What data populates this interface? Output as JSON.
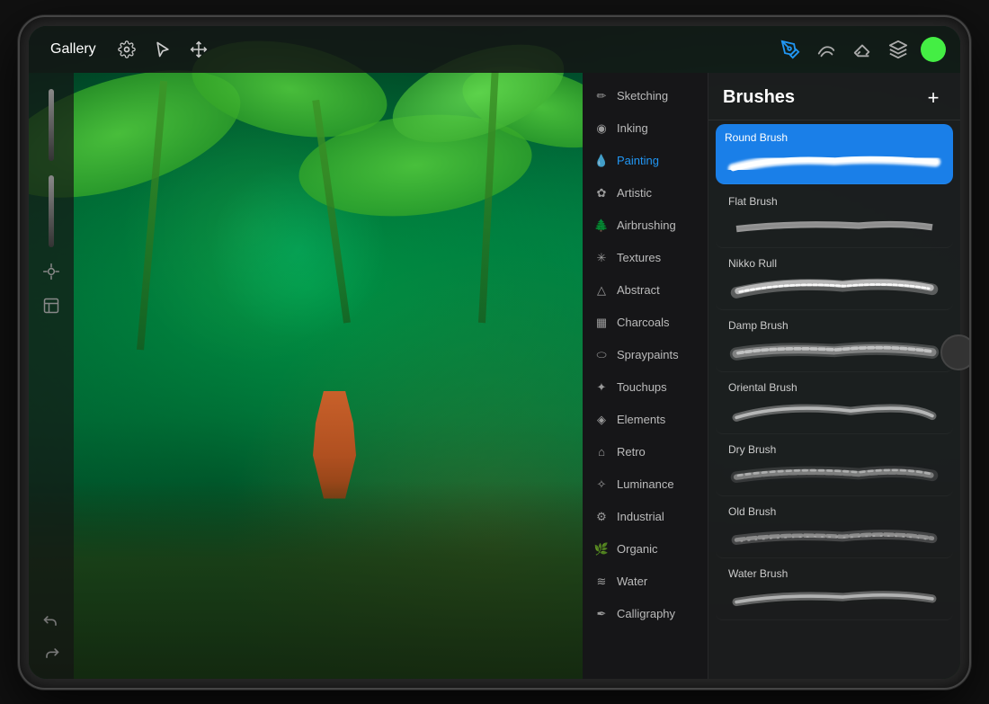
{
  "toolbar": {
    "gallery_label": "Gallery",
    "add_label": "+",
    "brushes_title": "Brushes",
    "tools": {
      "pen": "pen-active",
      "smudge": "smudge",
      "eraser": "eraser",
      "layers": "layers"
    }
  },
  "categories": [
    {
      "id": "sketching",
      "label": "Sketching",
      "icon": "✏️"
    },
    {
      "id": "inking",
      "label": "Inking",
      "icon": "💧"
    },
    {
      "id": "painting",
      "label": "Painting",
      "icon": "💧",
      "active": true
    },
    {
      "id": "artistic",
      "label": "Artistic",
      "icon": "🌸"
    },
    {
      "id": "airbrushing",
      "label": "Airbrushing",
      "icon": "🌲"
    },
    {
      "id": "textures",
      "label": "Textures",
      "icon": "✳️"
    },
    {
      "id": "abstract",
      "label": "Abstract",
      "icon": "△"
    },
    {
      "id": "charcoals",
      "label": "Charcoals",
      "icon": "▦"
    },
    {
      "id": "spraypaints",
      "label": "Spraypaints",
      "icon": "💊"
    },
    {
      "id": "touchups",
      "label": "Touchups",
      "icon": "✧"
    },
    {
      "id": "elements",
      "label": "Elements",
      "icon": "◈"
    },
    {
      "id": "retro",
      "label": "Retro",
      "icon": "⌂"
    },
    {
      "id": "luminance",
      "label": "Luminance",
      "icon": "✦"
    },
    {
      "id": "industrial",
      "label": "Industrial",
      "icon": "⚙"
    },
    {
      "id": "organic",
      "label": "Organic",
      "icon": "🌿"
    },
    {
      "id": "water",
      "label": "Water",
      "icon": "≋"
    },
    {
      "id": "calligraphy",
      "label": "Calligraphy",
      "icon": "✒"
    }
  ],
  "brushes": [
    {
      "id": "round-brush",
      "name": "Round Brush",
      "selected": true
    },
    {
      "id": "flat-brush",
      "name": "Flat Brush",
      "selected": false
    },
    {
      "id": "nikko-rull",
      "name": "Nikko Rull",
      "selected": false
    },
    {
      "id": "damp-brush",
      "name": "Damp Brush",
      "selected": false
    },
    {
      "id": "oriental-brush",
      "name": "Oriental Brush",
      "selected": false
    },
    {
      "id": "dry-brush",
      "name": "Dry Brush",
      "selected": false
    },
    {
      "id": "old-brush",
      "name": "Old Brush",
      "selected": false
    },
    {
      "id": "water-brush",
      "name": "Water Brush",
      "selected": false
    }
  ],
  "color": {
    "active": "#44ee44"
  }
}
